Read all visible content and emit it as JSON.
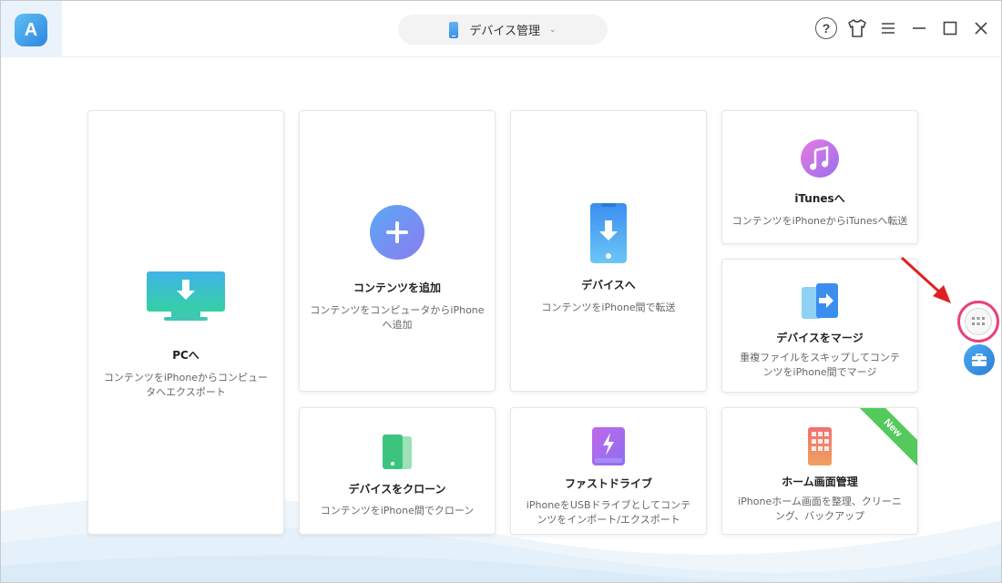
{
  "header": {
    "logo_letter": "A",
    "device_label": "デバイス管理",
    "controls": [
      "help-icon",
      "skin-icon",
      "menu-icon",
      "minimize-icon",
      "maximize-icon",
      "close-icon"
    ]
  },
  "cards": {
    "to_pc": {
      "title": "PCへ",
      "desc": "コンテンツをiPhoneからコンピュータへエクスポート",
      "icon": "monitor-download-icon"
    },
    "add_content": {
      "title": "コンテンツを追加",
      "desc": "コンテンツをコンピュータからiPhoneへ追加",
      "icon": "plus-circle-icon"
    },
    "to_device": {
      "title": "デバイスへ",
      "desc": "コンテンツをiPhone間で転送",
      "icon": "phone-download-icon"
    },
    "to_itunes": {
      "title": "iTunesへ",
      "desc": "コンテンツをiPhoneからiTunesへ転送",
      "icon": "music-note-icon"
    },
    "merge_device": {
      "title": "デバイスをマージ",
      "desc": "重複ファイルをスキップしてコンテンツをiPhone間でマージ",
      "icon": "merge-devices-icon"
    },
    "clone_device": {
      "title": "デバイスをクローン",
      "desc": "コンテンツをiPhone間でクローン",
      "icon": "clone-phones-icon"
    },
    "fast_drive": {
      "title": "ファストドライブ",
      "desc": "iPhoneをUSBドライブとしてコンテンツをインポート/エクスポート",
      "icon": "usb-drive-icon"
    },
    "home_screen": {
      "title": "ホーム画面管理",
      "desc": "iPhoneホーム画面を整理、クリーニング、バックアップ",
      "icon": "home-grid-icon",
      "badge": "New"
    }
  },
  "side": {
    "grid_icon": "app-grid-icon",
    "tool_icon": "toolbox-icon"
  },
  "colors": {
    "accent": "#3a8ee6",
    "highlight_ring": "#e8427a",
    "arrow": "#e02020",
    "new_badge": "#54c95c"
  }
}
